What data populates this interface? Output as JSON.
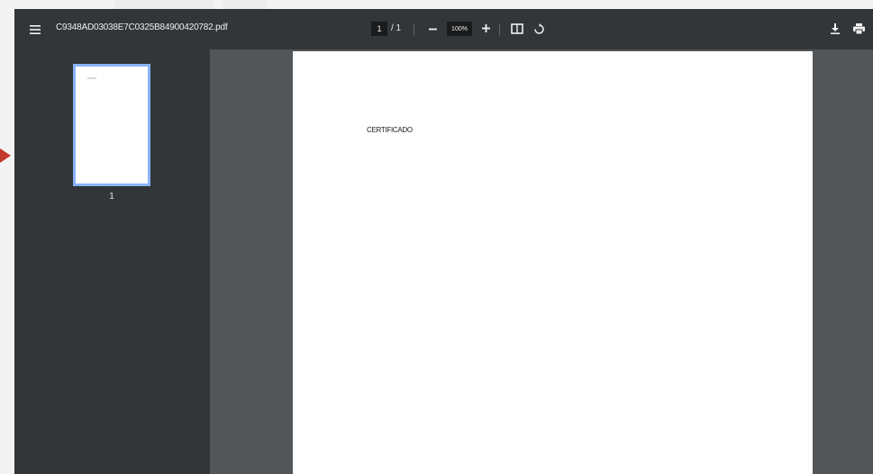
{
  "colors": {
    "toolbar_bg": "#323639",
    "sidebar_bg": "#323639",
    "content_bg": "#525659",
    "page_bg": "#ffffff",
    "thumbnail_border": "#8ab4f8",
    "arrow": "#c0392b"
  },
  "toolbar": {
    "menu_icon": "hamburger-menu-icon",
    "file_name": "C9348AD03038E7C0325B84900420782.pdf",
    "current_page": "1",
    "page_separator": "/ 1",
    "zoom_out_icon": "minus-icon",
    "zoom_level": "100%",
    "zoom_in_icon": "plus-icon",
    "fit_icon": "fit-to-page-icon",
    "rotate_icon": "rotate-icon",
    "download_icon": "download-icon",
    "print_icon": "print-icon"
  },
  "sidebar": {
    "thumbnails": [
      {
        "page_number": "1"
      }
    ]
  },
  "document": {
    "pages": [
      {
        "text": "CERTIFICADO"
      }
    ]
  }
}
